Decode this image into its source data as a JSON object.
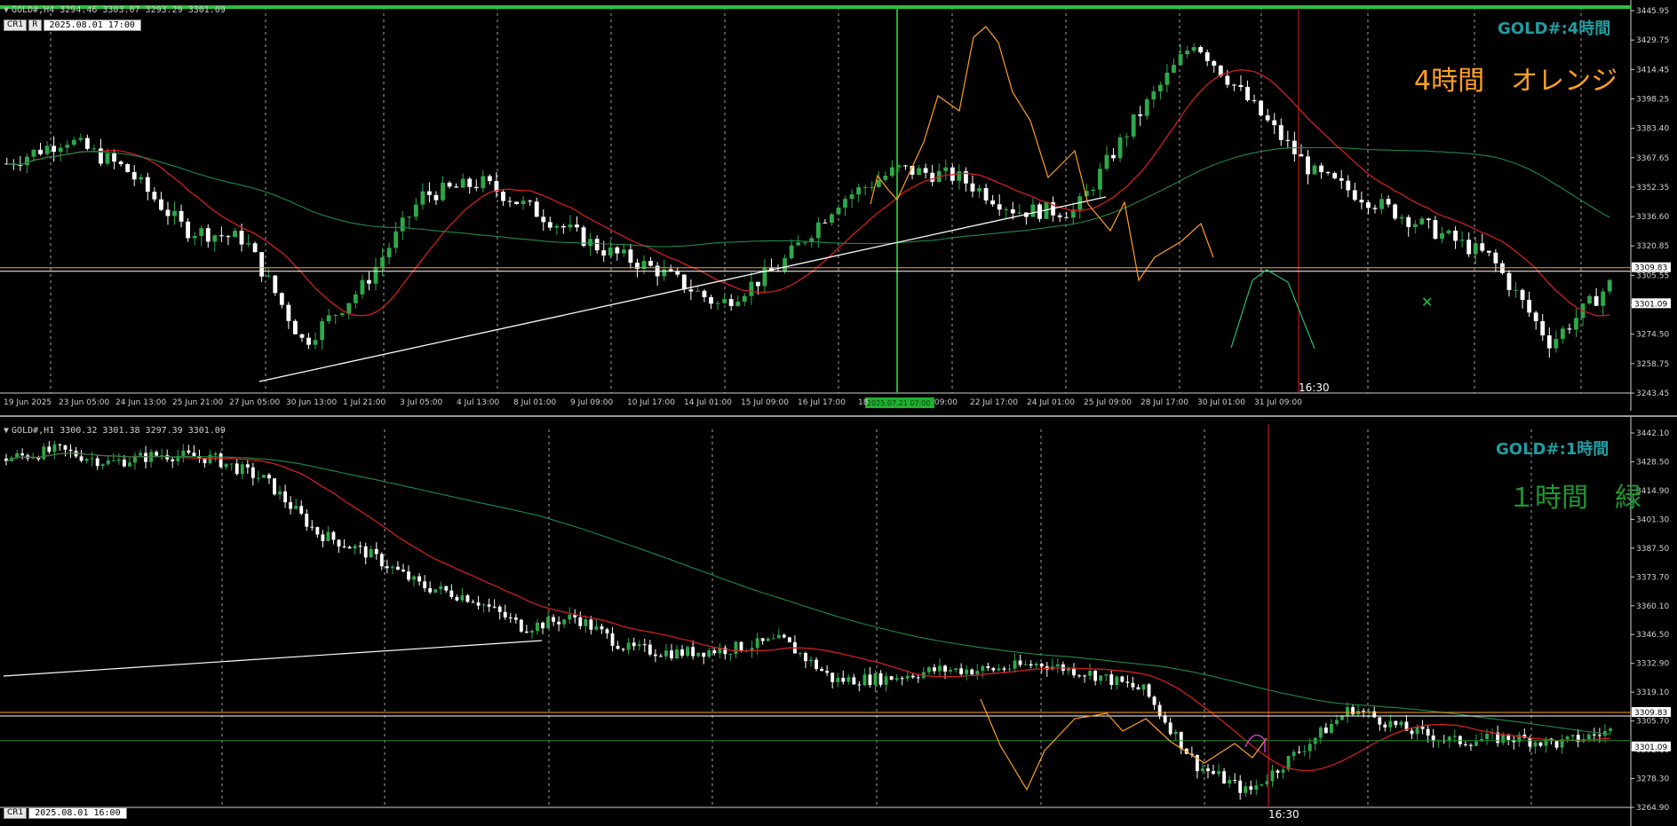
{
  "top": {
    "header": "GOLD#,H4  3294.46 3303.07 3293.29 3301.09",
    "cr_label": "CR1",
    "r_label": "R",
    "cursor_time": "2025.08.01 17:00",
    "title": "GOLD#:4時間",
    "subtitle": "4時間　オレンジ",
    "now_label": "16:30",
    "marker_time": "2025.07.21 07:00",
    "price_ticks": [
      "3445.95",
      "3429.75",
      "3414.45",
      "3398.25",
      "3383.40",
      "3367.65",
      "3352.35",
      "3336.60",
      "3320.85",
      "3305.55",
      "3289.80",
      "3274.50",
      "3258.75",
      "3243.45"
    ],
    "price_labels": [
      "3309.83",
      "3301.09"
    ],
    "time_ticks": [
      "19 Jun 2025",
      "23 Jun 05:00",
      "24 Jun 13:00",
      "25 Jun 21:00",
      "27 Jun 05:00",
      "30 Jun 13:00",
      "1 Jul 21:00",
      "3 Jul 05:00",
      "4 Jul 13:00",
      "8 Jul 01:00",
      "9 Jul 09:00",
      "10 Jul 17:00",
      "14 Jul 01:00",
      "15 Jul 09:00",
      "16 Jul 17:00",
      "18",
      "09:00",
      "22 Jul 17:00",
      "24 Jul 01:00",
      "25 Jul 09:00",
      "28 Jul 17:00",
      "30 Jul 01:00",
      "31 Jul 09:00"
    ]
  },
  "bottom": {
    "header": "GOLD#,H1  3300.32 3301.38 3297.39 3301.09",
    "cr_label": "CR1",
    "cursor_time": "2025.08.01 16:00",
    "title": "GOLD#:1時間",
    "subtitle": "１時間　緑",
    "now_label": "16:30",
    "price_ticks": [
      "3442.10",
      "3428.50",
      "3414.90",
      "3401.30",
      "3387.50",
      "3373.70",
      "3360.10",
      "3346.50",
      "3332.90",
      "3319.10",
      "3305.70",
      "3292.10",
      "3278.30",
      "3264.90"
    ],
    "price_labels": [
      "3309.83",
      "3301.09"
    ]
  },
  "colors": {
    "bull": "#2ea84a",
    "bear": "#ffffff",
    "ma_fast": "#d01f1f",
    "ma_slow": "#1e8a4a",
    "orange": "#ffa020",
    "green_text": "#1e9a30",
    "title_teal": "#1f9ea3",
    "grid": "#cfcfcf"
  },
  "chart_data": [
    {
      "type": "line",
      "title": "GOLD#:4時間",
      "timeframe": "H4",
      "ylim": [
        3243.45,
        3445.95
      ],
      "x": [
        "19 Jun",
        "23 Jun",
        "24 Jun",
        "25 Jun",
        "27 Jun",
        "30 Jun",
        "1 Jul",
        "3 Jul",
        "4 Jul",
        "8 Jul",
        "9 Jul",
        "10 Jul",
        "14 Jul",
        "15 Jul",
        "16 Jul",
        "18 Jul",
        "21 Jul",
        "22 Jul",
        "24 Jul",
        "25 Jul",
        "28 Jul",
        "30 Jul",
        "31 Jul",
        "1 Aug"
      ],
      "series": [
        {
          "values": [
            3365,
            3378,
            3362,
            3330,
            3325,
            3270,
            3300,
            3348,
            3355,
            3338,
            3320,
            3308,
            3290,
            3310,
            3345,
            3362,
            3358,
            3340,
            3340,
            3388,
            3430,
            3395,
            3360,
            3345,
            3330,
            3315,
            3270,
            3301
          ]
        }
      ],
      "horizontal_lines": [
        3309.83,
        3301.09
      ]
    },
    {
      "type": "line",
      "title": "GOLD#:1時間",
      "timeframe": "H1",
      "ylim": [
        3264.9,
        3442.1
      ],
      "series": [
        {
          "values": [
            3430,
            3434,
            3428,
            3432,
            3430,
            3420,
            3395,
            3385,
            3370,
            3364,
            3350,
            3355,
            3340,
            3338,
            3340,
            3344,
            3325,
            3326,
            3330,
            3330,
            3333,
            3328,
            3320,
            3285,
            3272,
            3292,
            3312,
            3302,
            3296,
            3298,
            3295,
            3301
          ]
        }
      ],
      "horizontal_lines": [
        3309.83,
        3301.09,
        3296.5
      ]
    }
  ]
}
